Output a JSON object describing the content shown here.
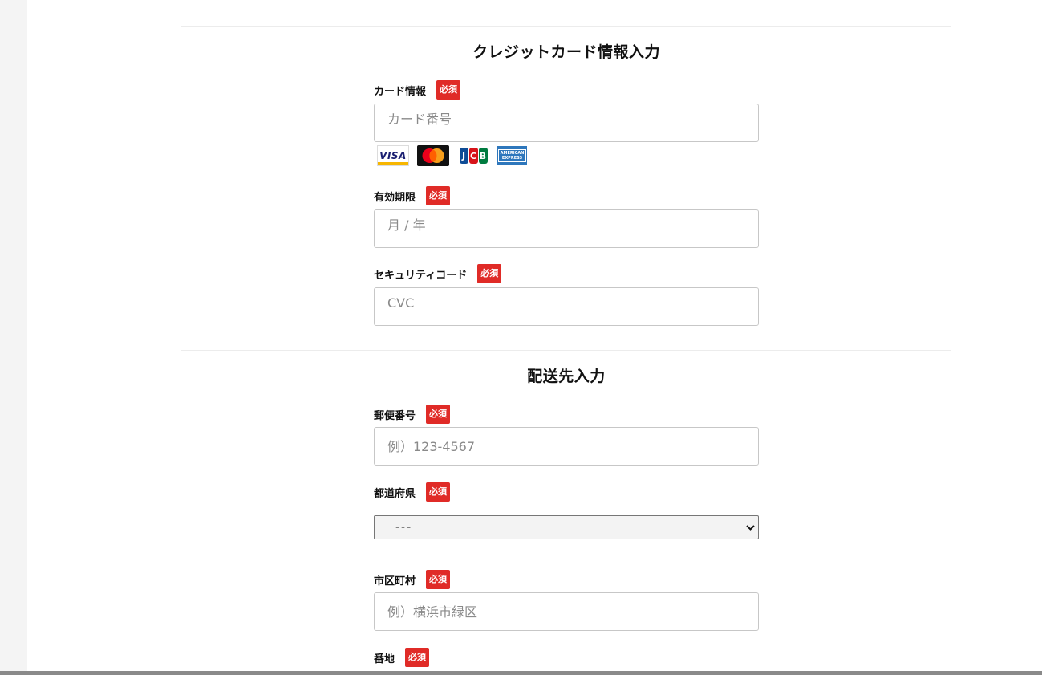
{
  "credit_section": {
    "title": "クレジットカード情報入力",
    "card": {
      "label": "カード情報",
      "required": "必須",
      "placeholder": "カード番号"
    },
    "brands": {
      "visa": "VISA",
      "jcb": [
        "J",
        "C",
        "B"
      ],
      "amex": "AMERICAN EXPRESS"
    },
    "expiry": {
      "label": "有効期限",
      "required": "必須",
      "placeholder": "月 / 年"
    },
    "cvc": {
      "label": "セキュリティコード",
      "required": "必須",
      "placeholder": "CVC"
    }
  },
  "shipping_section": {
    "title": "配送先入力",
    "postal": {
      "label": "郵便番号",
      "required": "必須",
      "placeholder": "例）123-4567"
    },
    "prefecture": {
      "label": "都道府県",
      "required": "必須",
      "selected": "---"
    },
    "city": {
      "label": "市区町村",
      "required": "必須",
      "placeholder": "例）横浜市緑区"
    },
    "address": {
      "label": "番地",
      "required": "必須"
    }
  },
  "colors": {
    "required_badge": "#e02b27",
    "visa_blue": "#1a1f71",
    "visa_gold": "#f7b600",
    "mastercard_red": "#eb001b",
    "mastercard_orange": "#f79e1b",
    "jcb_blue": "#0e4c96",
    "jcb_red": "#d7141a",
    "jcb_green": "#007b40",
    "amex_blue": "#2e77bc"
  }
}
